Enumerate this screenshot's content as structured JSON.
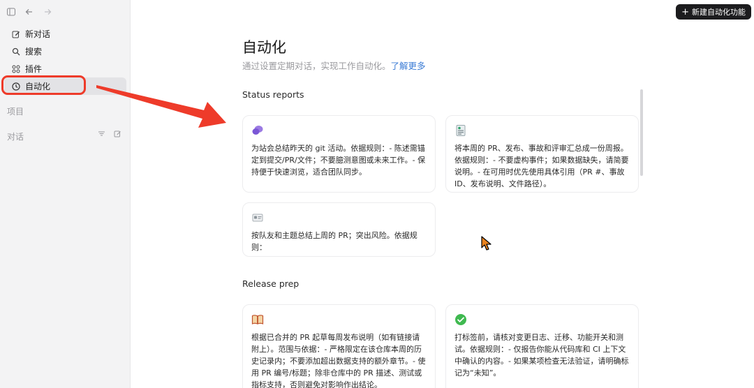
{
  "sidebar": {
    "nav": [
      {
        "label": "新对话",
        "icon": "edit-icon"
      },
      {
        "label": "搜索",
        "icon": "search-icon"
      },
      {
        "label": "插件",
        "icon": "plugins-icon"
      },
      {
        "label": "自动化",
        "icon": "clock-icon"
      }
    ],
    "projects_label": "项目",
    "conversations_label": "对话"
  },
  "header": {
    "new_button_label": "新建自动化功能"
  },
  "main": {
    "title": "自动化",
    "subtitle": "通过设置定期对话，实现工作自动化。",
    "learn_more": "了解更多",
    "sections": [
      {
        "title": "Status reports",
        "cards": [
          {
            "icon": "chat-bubbles-icon",
            "text": "为站会总结昨天的 git 活动。依据规则：- 陈述需锚定到提交/PR/文件；不要臆测意图或未来工作。- 保持便于快速浏览，适合团队同步。"
          },
          {
            "icon": "report-icon",
            "text": "将本周的 PR、发布、事故和评审汇总成一份周报。依据规则：- 不要虚构事件；如果数据缺失，请简要说明。- 在可用时优先使用具体引用（PR #、事故 ID、发布说明、文件路径）。"
          },
          {
            "icon": "id-card-icon",
            "text": "按队友和主题总结上周的 PR；突出风险。依据规则："
          }
        ]
      },
      {
        "title": "Release prep",
        "cards": [
          {
            "icon": "book-icon",
            "text": "根据已合并的 PR 起草每周发布说明（如有链接请附上）。范围与依据：- 严格限定在该仓库本周的历史记录内；不要添加超出数据支持的额外章节。- 使用 PR 编号/标题；除非仓库中的 PR 描述、测试或指标支持，否则避免对影响作出结论。"
          },
          {
            "icon": "check-circle-icon",
            "text": "打标签前，请核对变更日志、迁移、功能开关和测试。依据规则：- 仅报告你能从代码库和 CI 上下文中确认的内容。- 如果某项检查无法验证，请明确标记为“未知”。"
          }
        ]
      }
    ]
  },
  "colors": {
    "accent_red": "#ee3b2a",
    "link_blue": "#3a7bd5"
  }
}
